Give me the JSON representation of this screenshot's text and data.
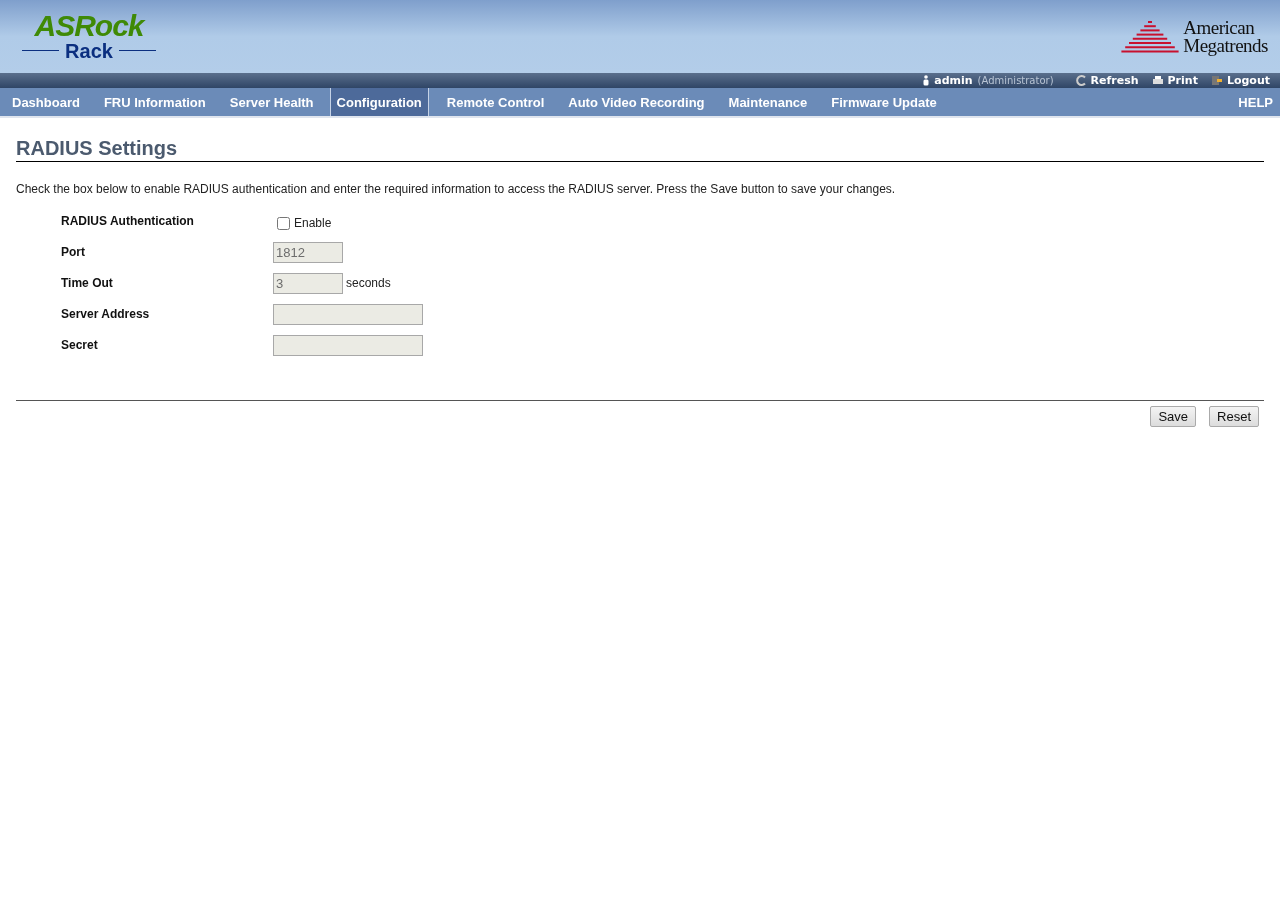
{
  "header": {
    "logo_left": {
      "top": "ASRock",
      "bottom": "Rack"
    },
    "logo_right": {
      "line1": "American",
      "line2": "Megatrends"
    }
  },
  "user_bar": {
    "user": "admin",
    "role": "(Administrator)",
    "actions": [
      {
        "kind": "refresh",
        "label": "Refresh"
      },
      {
        "kind": "print",
        "label": "Print"
      },
      {
        "kind": "logout",
        "label": "Logout"
      }
    ]
  },
  "nav": {
    "items": [
      {
        "label": "Dashboard",
        "selected": false
      },
      {
        "label": "FRU Information",
        "selected": false
      },
      {
        "label": "Server Health",
        "selected": false
      },
      {
        "label": "Configuration",
        "selected": true
      },
      {
        "label": "Remote Control",
        "selected": false
      },
      {
        "label": "Auto Video Recording",
        "selected": false
      },
      {
        "label": "Maintenance",
        "selected": false
      },
      {
        "label": "Firmware Update",
        "selected": false
      }
    ],
    "help": "HELP"
  },
  "page": {
    "title": "RADIUS Settings",
    "description": "Check the box below to enable RADIUS authentication and enter the required information to access the RADIUS server. Press the Save button to save your changes."
  },
  "form": [
    {
      "kind": "checkbox",
      "label": "RADIUS Authentication",
      "option": "Enable",
      "checked": false
    },
    {
      "kind": "number",
      "label": "Port",
      "value": "1812",
      "disabled": true
    },
    {
      "kind": "number",
      "label": "Time Out",
      "value": "3",
      "unit": "seconds",
      "disabled": true
    },
    {
      "kind": "text",
      "label": "Server Address",
      "disabled": true
    },
    {
      "kind": "text",
      "label": "Secret",
      "disabled": true
    }
  ],
  "buttons": [
    "Save",
    "Reset"
  ]
}
